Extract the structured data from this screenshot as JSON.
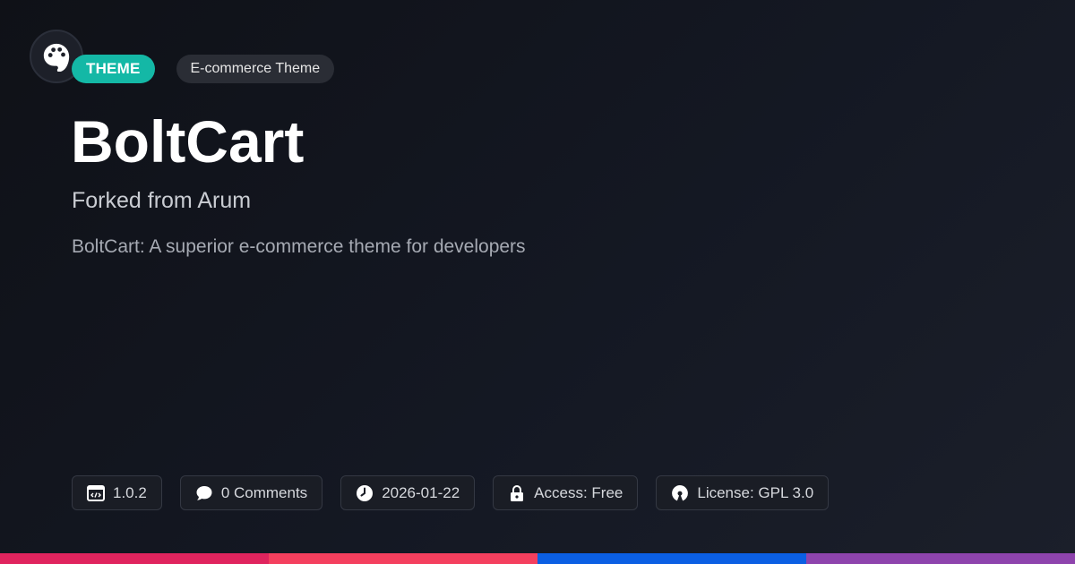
{
  "badge": {
    "type_label": "THEME",
    "category": "E-commerce Theme"
  },
  "title": "BoltCart",
  "subtitle": "Forked from Arum",
  "description": "BoltCart: A superior e-commerce theme for developers",
  "meta": [
    {
      "icon": "code-window-icon",
      "text": "1.0.2"
    },
    {
      "icon": "comment-icon",
      "text": "0 Comments"
    },
    {
      "icon": "clock-icon",
      "text": "2026-01-22"
    },
    {
      "icon": "lock-icon",
      "text": "Access: Free"
    },
    {
      "icon": "open-source-icon",
      "text": "License: GPL 3.0"
    }
  ],
  "colors": {
    "accent": "#14b8a6",
    "bar": [
      "#e0245e",
      "#f43f5e",
      "#0b5fe3",
      "#8e44ad"
    ]
  }
}
